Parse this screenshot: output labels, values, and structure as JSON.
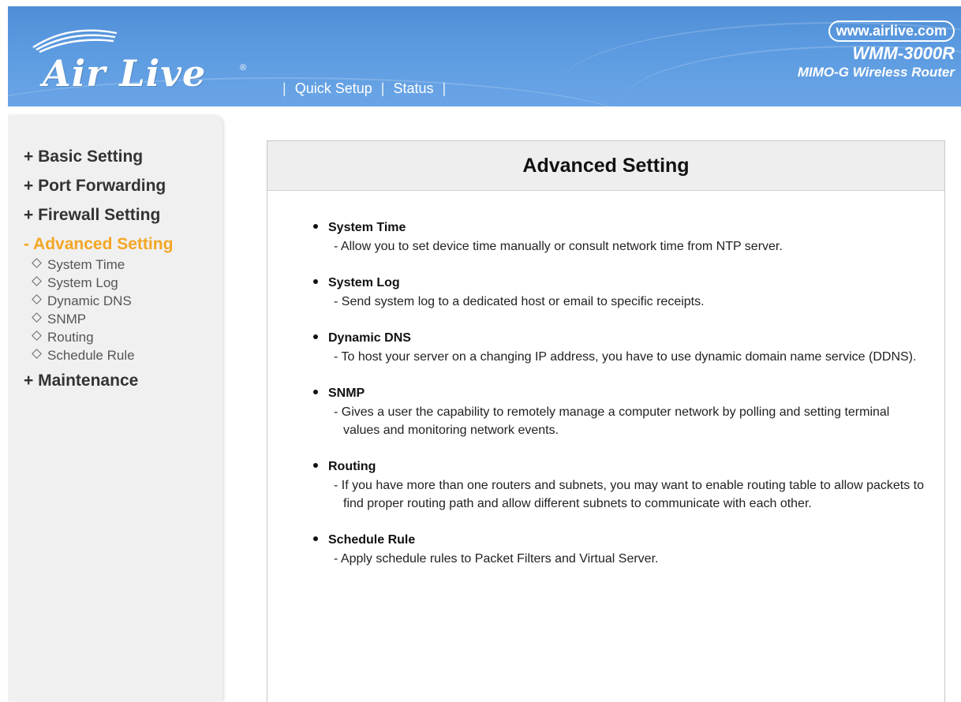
{
  "header": {
    "logo_text": "Air Live",
    "logo_reg": "®",
    "nav": [
      {
        "label": "Quick Setup"
      },
      {
        "label": "Status"
      }
    ],
    "url": "www.airlive.com",
    "model": "WMM-3000R",
    "model_desc": "MIMO-G Wireless Router",
    "colors": {
      "header_bg": "#5b9ae0",
      "active_menu": "#f5a623"
    }
  },
  "sidebar": {
    "sections": [
      {
        "label": "+ Basic Setting"
      },
      {
        "label": "+ Port Forwarding"
      },
      {
        "label": "+ Firewall Setting"
      },
      {
        "label": "- Advanced Setting"
      },
      {
        "label": "+ Maintenance"
      }
    ],
    "submenu": [
      {
        "label": "System Time"
      },
      {
        "label": "System Log"
      },
      {
        "label": "Dynamic DNS"
      },
      {
        "label": "SNMP"
      },
      {
        "label": "Routing"
      },
      {
        "label": "Schedule Rule"
      }
    ]
  },
  "main": {
    "title": "Advanced Setting",
    "items": [
      {
        "title": "System Time",
        "desc": "- Allow you to set device time manually or consult network time from NTP server."
      },
      {
        "title": "System Log",
        "desc": "- Send system log to a dedicated host or email to specific receipts."
      },
      {
        "title": "Dynamic DNS",
        "desc": "- To host your server on a changing IP address, you have to use dynamic domain name service (DDNS)."
      },
      {
        "title": "SNMP",
        "desc": "- Gives a user the capability to remotely manage a computer network by polling and setting terminal values and monitoring network events."
      },
      {
        "title": "Routing",
        "desc": "- If you have more than one routers and subnets, you may want to enable routing table to allow packets to find proper routing path and allow different subnets to communicate with each other."
      },
      {
        "title": "Schedule Rule",
        "desc": "- Apply schedule rules to Packet Filters and Virtual Server."
      }
    ]
  }
}
